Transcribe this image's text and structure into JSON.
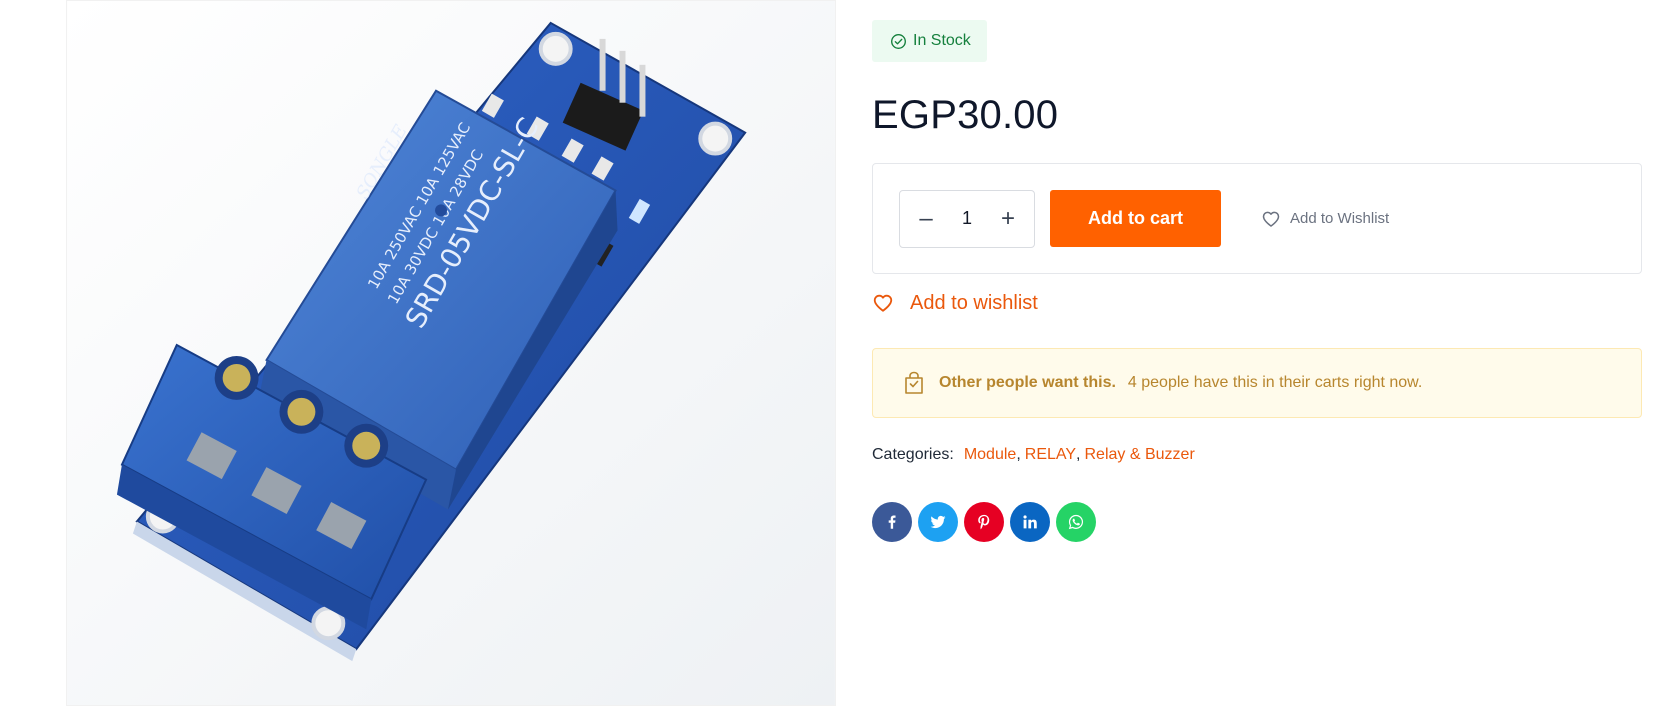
{
  "product": {
    "image_alt": "SRD-05VDC-SL-C relay module",
    "stock_status": "In Stock",
    "price": "EGP30.00",
    "quantity": "1",
    "add_to_cart_label": "Add to cart",
    "add_to_wishlist_inline": "Add to Wishlist",
    "add_to_wishlist_link": "Add to wishlist"
  },
  "social_proof": {
    "headline": "Other people want this.",
    "message": "4 people have this in their carts right now."
  },
  "categories": {
    "label": "Categories:",
    "items": [
      "Module",
      "RELAY",
      "Relay & Buzzer"
    ]
  },
  "share": [
    {
      "icon": "facebook-icon",
      "color": "#3b5998"
    },
    {
      "icon": "twitter-icon",
      "color": "#1da1f2"
    },
    {
      "icon": "pinterest-icon",
      "color": "#e60023"
    },
    {
      "icon": "linkedin-icon",
      "color": "#0a66c2"
    },
    {
      "icon": "whatsapp-icon",
      "color": "#25d366"
    }
  ],
  "colors": {
    "accent": "#ff6100",
    "stock_green": "#15803d",
    "notice_gold": "#b7862e"
  }
}
